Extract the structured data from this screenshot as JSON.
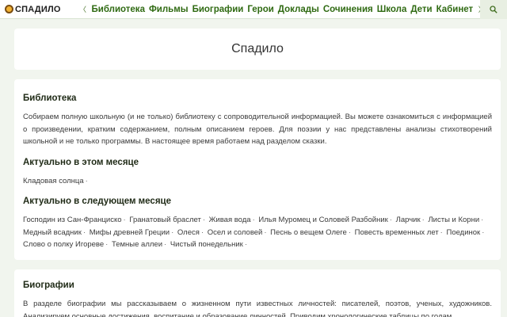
{
  "header": {
    "logo_text": "СПАДИЛО",
    "nav_prev": "〈",
    "nav_next": "〉",
    "nav_items": [
      "Библиотека",
      "Фильмы",
      "Биографии",
      "Герои",
      "Доклады",
      "Сочинения",
      "Школа",
      "Дети",
      "Кабинет"
    ],
    "search_icon": "search-icon"
  },
  "hero": {
    "title": "Спадило"
  },
  "library": {
    "title": "Библиотека",
    "text": "Собираем полную школьную (и не только) библиотеку с сопроводительной информацией. Вы можете ознакомиться с информацией о произведении, кратким содержанием, полным описанием героев. Для поэзии у нас представлены анализы стихотворений школьной и не только программы. В настоящее время работаем над разделом сказки.",
    "current_title": "Актуально в этом месяце",
    "current_items": [
      "Кладовая солнца"
    ],
    "next_title": "Актуально в следующем месяце",
    "next_items": [
      "Господин из Сан-Франциско",
      "Гранатовый браслет",
      "Живая вода",
      "Илья Муромец и Соловей Разбойник",
      "Ларчик",
      "Листы и Корни",
      "Медный всадник",
      "Мифы древней Греции",
      "Олеся",
      "Осел и соловей",
      "Песнь о вещем Олеге",
      "Повесть временных лет",
      "Поединок",
      "Слово о полку Игореве",
      "Темные аллеи",
      "Чистый понедельник"
    ],
    "separator": "·"
  },
  "biographies": {
    "title": "Биографии",
    "text": "В разделе биографии мы рассказываем о жизненном пути известных личностей: писателей, поэтов, ученых, художников. Анализируем основные достижения, воспитание и образование личностей. Приводим хронологические таблицы по годам."
  },
  "colors": {
    "accent": "#2f6a12",
    "background": "#f1f5ee",
    "card": "#ffffff"
  }
}
